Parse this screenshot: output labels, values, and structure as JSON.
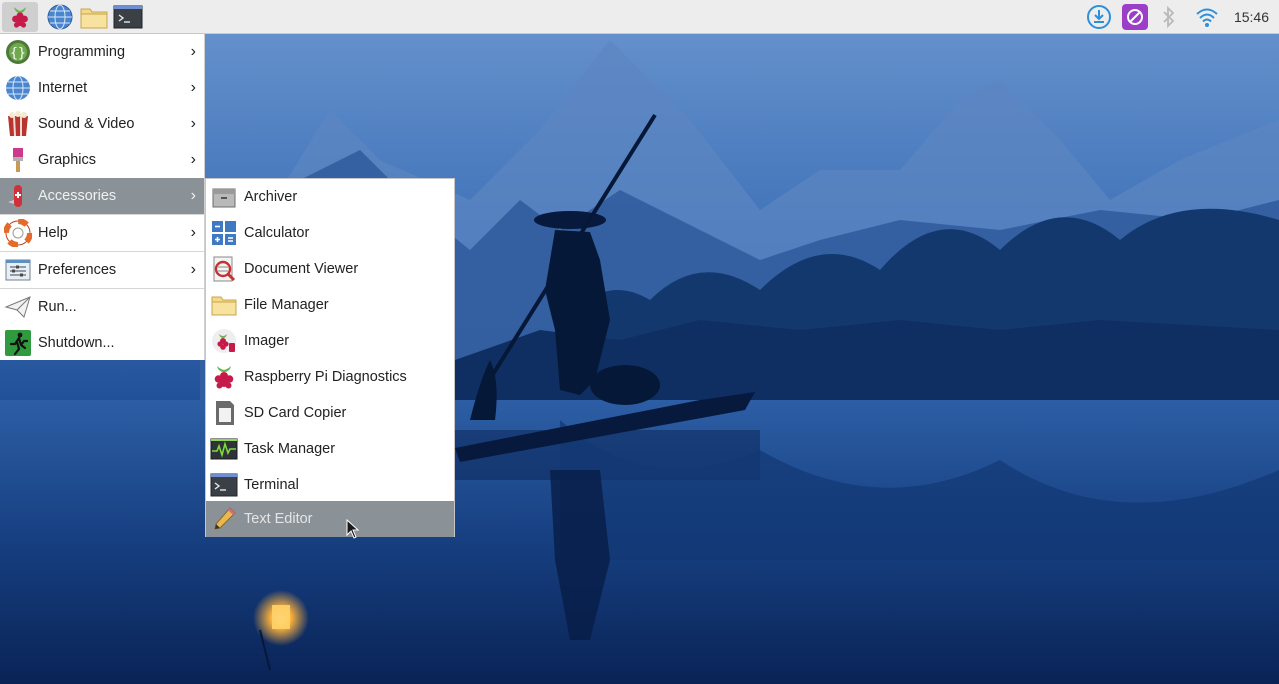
{
  "taskbar": {
    "launchers": [
      {
        "icon": "raspberry-pi-icon"
      },
      {
        "icon": "web-browser-icon"
      },
      {
        "icon": "file-manager-icon"
      },
      {
        "icon": "terminal-icon"
      }
    ],
    "tray": [
      {
        "icon": "updater-download-icon"
      },
      {
        "icon": "vnc-icon"
      },
      {
        "icon": "bluetooth-icon"
      },
      {
        "icon": "wifi-icon"
      }
    ],
    "clock": "15:46"
  },
  "main_menu": {
    "items": [
      {
        "label": "Programming",
        "icon": "programming-icon",
        "submenu": true
      },
      {
        "label": "Internet",
        "icon": "internet-globe-icon",
        "submenu": true
      },
      {
        "label": "Sound & Video",
        "icon": "sound-video-icon",
        "submenu": true
      },
      {
        "label": "Graphics",
        "icon": "graphics-brush-icon",
        "submenu": true
      },
      {
        "label": "Accessories",
        "icon": "accessories-knife-icon",
        "submenu": true,
        "active": true
      },
      {
        "label": "Help",
        "icon": "help-lifebuoy-icon",
        "submenu": true
      },
      {
        "label": "Preferences",
        "icon": "preferences-icon",
        "submenu": true
      },
      {
        "label": "Run...",
        "icon": "run-paper-plane-icon"
      },
      {
        "label": "Shutdown...",
        "icon": "shutdown-exit-icon"
      }
    ]
  },
  "accessories_menu": {
    "items": [
      {
        "label": "Archiver",
        "icon": "archiver-icon"
      },
      {
        "label": "Calculator",
        "icon": "calculator-icon"
      },
      {
        "label": "Document Viewer",
        "icon": "document-viewer-icon"
      },
      {
        "label": "File Manager",
        "icon": "folder-icon"
      },
      {
        "label": "Imager",
        "icon": "imager-icon"
      },
      {
        "label": "Raspberry Pi Diagnostics",
        "icon": "raspberry-pi-icon"
      },
      {
        "label": "SD Card Copier",
        "icon": "sd-card-icon"
      },
      {
        "label": "Task Manager",
        "icon": "task-manager-icon"
      },
      {
        "label": "Terminal",
        "icon": "terminal-icon"
      },
      {
        "label": "Text Editor",
        "icon": "pencil-icon",
        "active": true
      }
    ]
  },
  "colors": {
    "taskbar_bg": "#ededed",
    "menu_bg": "#ffffff",
    "menu_highlight": "#8a9298",
    "wallpaper_sky": "#2a5fa8",
    "wallpaper_water": "#0f3a78"
  }
}
